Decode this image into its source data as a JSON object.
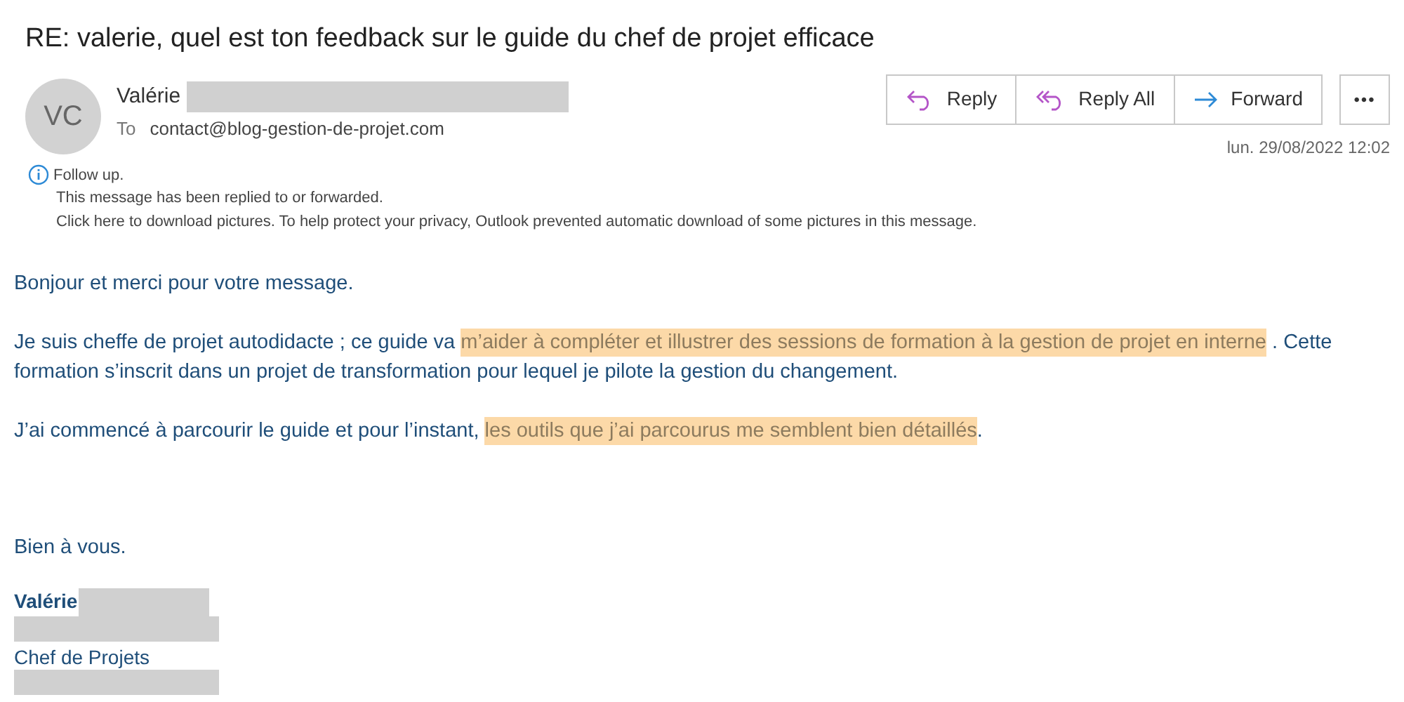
{
  "subject": "RE: valerie, quel est ton feedback sur le guide du chef de projet efficace",
  "sender": {
    "initials": "VC",
    "name": "Valérie",
    "redacted": true,
    "to_label": "To",
    "to": "contact@blog-gestion-de-projet.com"
  },
  "actions": [
    {
      "kind": "reply",
      "label": "Reply"
    },
    {
      "kind": "reply_all",
      "label": "Reply All"
    },
    {
      "kind": "forward",
      "label": "Forward"
    },
    {
      "kind": "more",
      "label": "•••"
    }
  ],
  "date": "lun. 29/08/2022 12:02",
  "info": [
    "Follow up.",
    "This message has been replied to or forwarded.",
    "Click here to download pictures. To help protect your privacy, Outlook prevented automatic download of some pictures in this message."
  ],
  "body": [
    [
      {
        "text": "Bonjour et merci pour votre message.",
        "highlighted": false
      }
    ],
    [
      {
        "text": "Je suis cheffe de projet autodidacte ; ce guide va ",
        "highlighted": false
      },
      {
        "text": "m’aider à compléter et illustrer des sessions de formation à la gestion de projet en interne",
        "highlighted": true
      },
      {
        "text": " . Cette formation s’inscrit  dans un projet de transformation pour lequel je pilote la gestion du changement.",
        "highlighted": false
      }
    ],
    [
      {
        "text": "J’ai commencé à parcourir le guide et pour l’instant, ",
        "highlighted": false
      },
      {
        "text": "les outils que j’ai parcourus me semblent bien détaillés",
        "highlighted": true
      },
      {
        "text": ".",
        "highlighted": false
      }
    ]
  ],
  "closing": "Bien à vous.",
  "signature": [
    {
      "kind": "name",
      "text": "Valérie",
      "redacted": true
    },
    {
      "kind": "redacted"
    },
    {
      "kind": "title",
      "text": "Chef de Projets"
    },
    {
      "kind": "redacted"
    }
  ]
}
